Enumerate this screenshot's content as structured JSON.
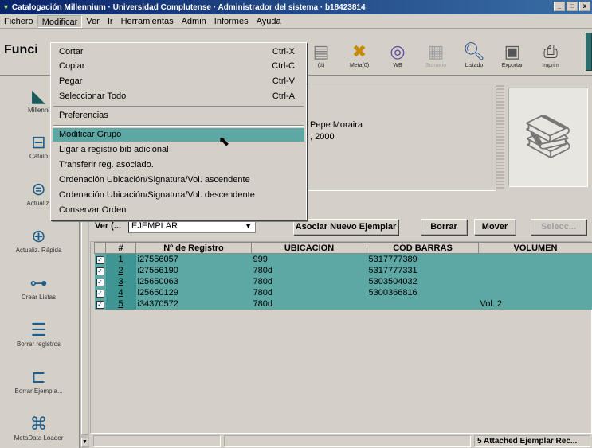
{
  "window": {
    "title": "Catalogación Millennium · Universidad Complutense · Administrador del sistema · b18423814",
    "controls": [
      "_",
      "□",
      "x"
    ]
  },
  "menubar": [
    "Fichero",
    "Modificar",
    "Ver",
    "Ir",
    "Herramientas",
    "Admin",
    "Informes",
    "Ayuda"
  ],
  "toolbar": {
    "function_title": "Funci",
    "buttons": [
      {
        "label": "(tt)",
        "icon": "record-icon"
      },
      {
        "label": "Meta(0)",
        "icon": "meta-icon"
      },
      {
        "label": "WB",
        "icon": "web-icon"
      },
      {
        "label": "Sumario",
        "icon": "summary-icon",
        "disabled": true
      },
      {
        "label": "Listado",
        "icon": "search-icon"
      },
      {
        "label": "Exportar",
        "icon": "export-icon"
      },
      {
        "label": "Imprim",
        "icon": "print-icon"
      }
    ]
  },
  "sidebar": [
    {
      "label": "Millenni",
      "icon": "millennium-icon"
    },
    {
      "label": "Catálo",
      "icon": "catalog-icon"
    },
    {
      "label": "Actualiz.",
      "icon": "update-icon"
    },
    {
      "label": "Actualiz. Rápida",
      "icon": "quick-update-icon"
    },
    {
      "label": "Crear Listas",
      "icon": "create-lists-icon"
    },
    {
      "label": "Borrar registros",
      "icon": "delete-records-icon"
    },
    {
      "label": "Borrar Ejempla...",
      "icon": "delete-items-icon"
    },
    {
      "label": "MetaData Loader",
      "icon": "metadata-loader-icon"
    }
  ],
  "record": {
    "line1": "Pepe Moraira",
    "line2": ", 2000"
  },
  "controls": {
    "ver_label": "Ver (...",
    "ver_value": "EJEMPLAR",
    "btn_asociar": "Asociar Nuevo Ejemplar",
    "btn_borrar": "Borrar",
    "btn_mover": "Mover",
    "btn_select": "Selecc..."
  },
  "table": {
    "headers": [
      "#",
      "Nº de Registro",
      "UBICACION",
      "COD BARRAS",
      "VOLUMEN"
    ],
    "rows": [
      {
        "num": "1",
        "registro": "i27556057",
        "ubicacion": "999",
        "cod": "5317777389",
        "vol": ""
      },
      {
        "num": "2",
        "registro": "i27556190",
        "ubicacion": "780d",
        "cod": "5317777331",
        "vol": ""
      },
      {
        "num": "3",
        "registro": "i25650063",
        "ubicacion": "780d",
        "cod": "5303504032",
        "vol": ""
      },
      {
        "num": "4",
        "registro": "i25650129",
        "ubicacion": "780d",
        "cod": "5300366816",
        "vol": ""
      },
      {
        "num": "5",
        "registro": "i34370572",
        "ubicacion": "780d",
        "cod": "",
        "vol": "Vol. 2"
      }
    ]
  },
  "status": {
    "right": "5 Attached Ejemplar Rec..."
  },
  "dropdown": [
    {
      "label": "Cortar",
      "shortcut": "Ctrl-X"
    },
    {
      "label": "Copiar",
      "shortcut": "Ctrl-C"
    },
    {
      "label": "Pegar",
      "shortcut": "Ctrl-V"
    },
    {
      "label": "Seleccionar Todo",
      "shortcut": "Ctrl-A"
    },
    {
      "label": "Preferencias",
      "shortcut": ""
    },
    {
      "label": "Modificar Grupo",
      "shortcut": ""
    },
    {
      "label": "Ligar a registro bib adicional",
      "shortcut": ""
    },
    {
      "label": "Transferir reg. asociado.",
      "shortcut": ""
    },
    {
      "label": "Ordenación Ubicación/Signatura/Vol. ascendente",
      "shortcut": ""
    },
    {
      "label": "Ordenación Ubicación/Signatura/Vol. descendente",
      "shortcut": ""
    },
    {
      "label": "Conservar Orden",
      "shortcut": ""
    }
  ],
  "colors": {
    "selection": "#5da7a5",
    "titlebar": "#0a246a"
  }
}
